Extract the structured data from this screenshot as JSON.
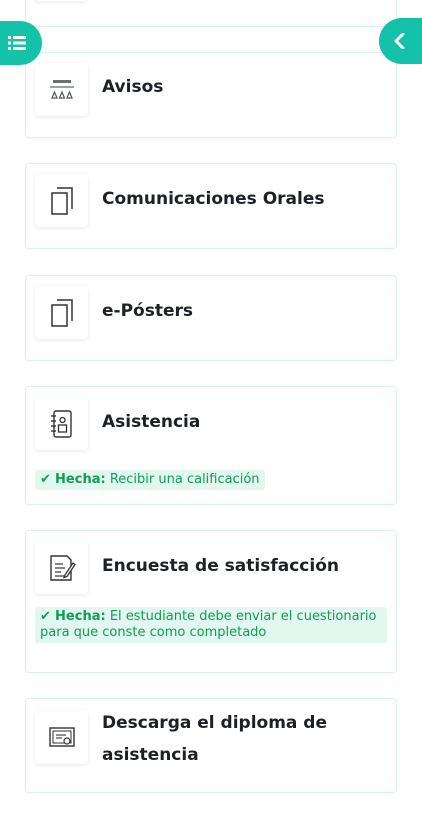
{
  "colors": {
    "accent": "#14c1a9",
    "success_text": "#0f9d58",
    "success_bg": "#e2f7ee",
    "border": "#d9f2ee"
  },
  "drawer_toggle": {
    "icon": "list-icon"
  },
  "course_index_toggle": {
    "icon": "chevron-left-icon"
  },
  "activities": [
    {
      "title": "Avisos",
      "icon": "forum-icon"
    },
    {
      "title": "Comunicaciones Orales",
      "icon": "folder-icon"
    },
    {
      "title": "e-Pósters",
      "icon": "folder-icon"
    },
    {
      "title": "Asistencia",
      "icon": "attendance-icon",
      "completion": {
        "status": "Hecha:",
        "text": "Recibir una calificación"
      }
    },
    {
      "title": "Encuesta de satisfacción",
      "icon": "feedback-icon",
      "completion": {
        "status": "Hecha:",
        "text": "El estudiante debe enviar el cuestionario para que conste como completado"
      }
    },
    {
      "title_line1": "Descarga el diploma de",
      "title_line2": "asistencia",
      "icon": "certificate-icon"
    }
  ]
}
